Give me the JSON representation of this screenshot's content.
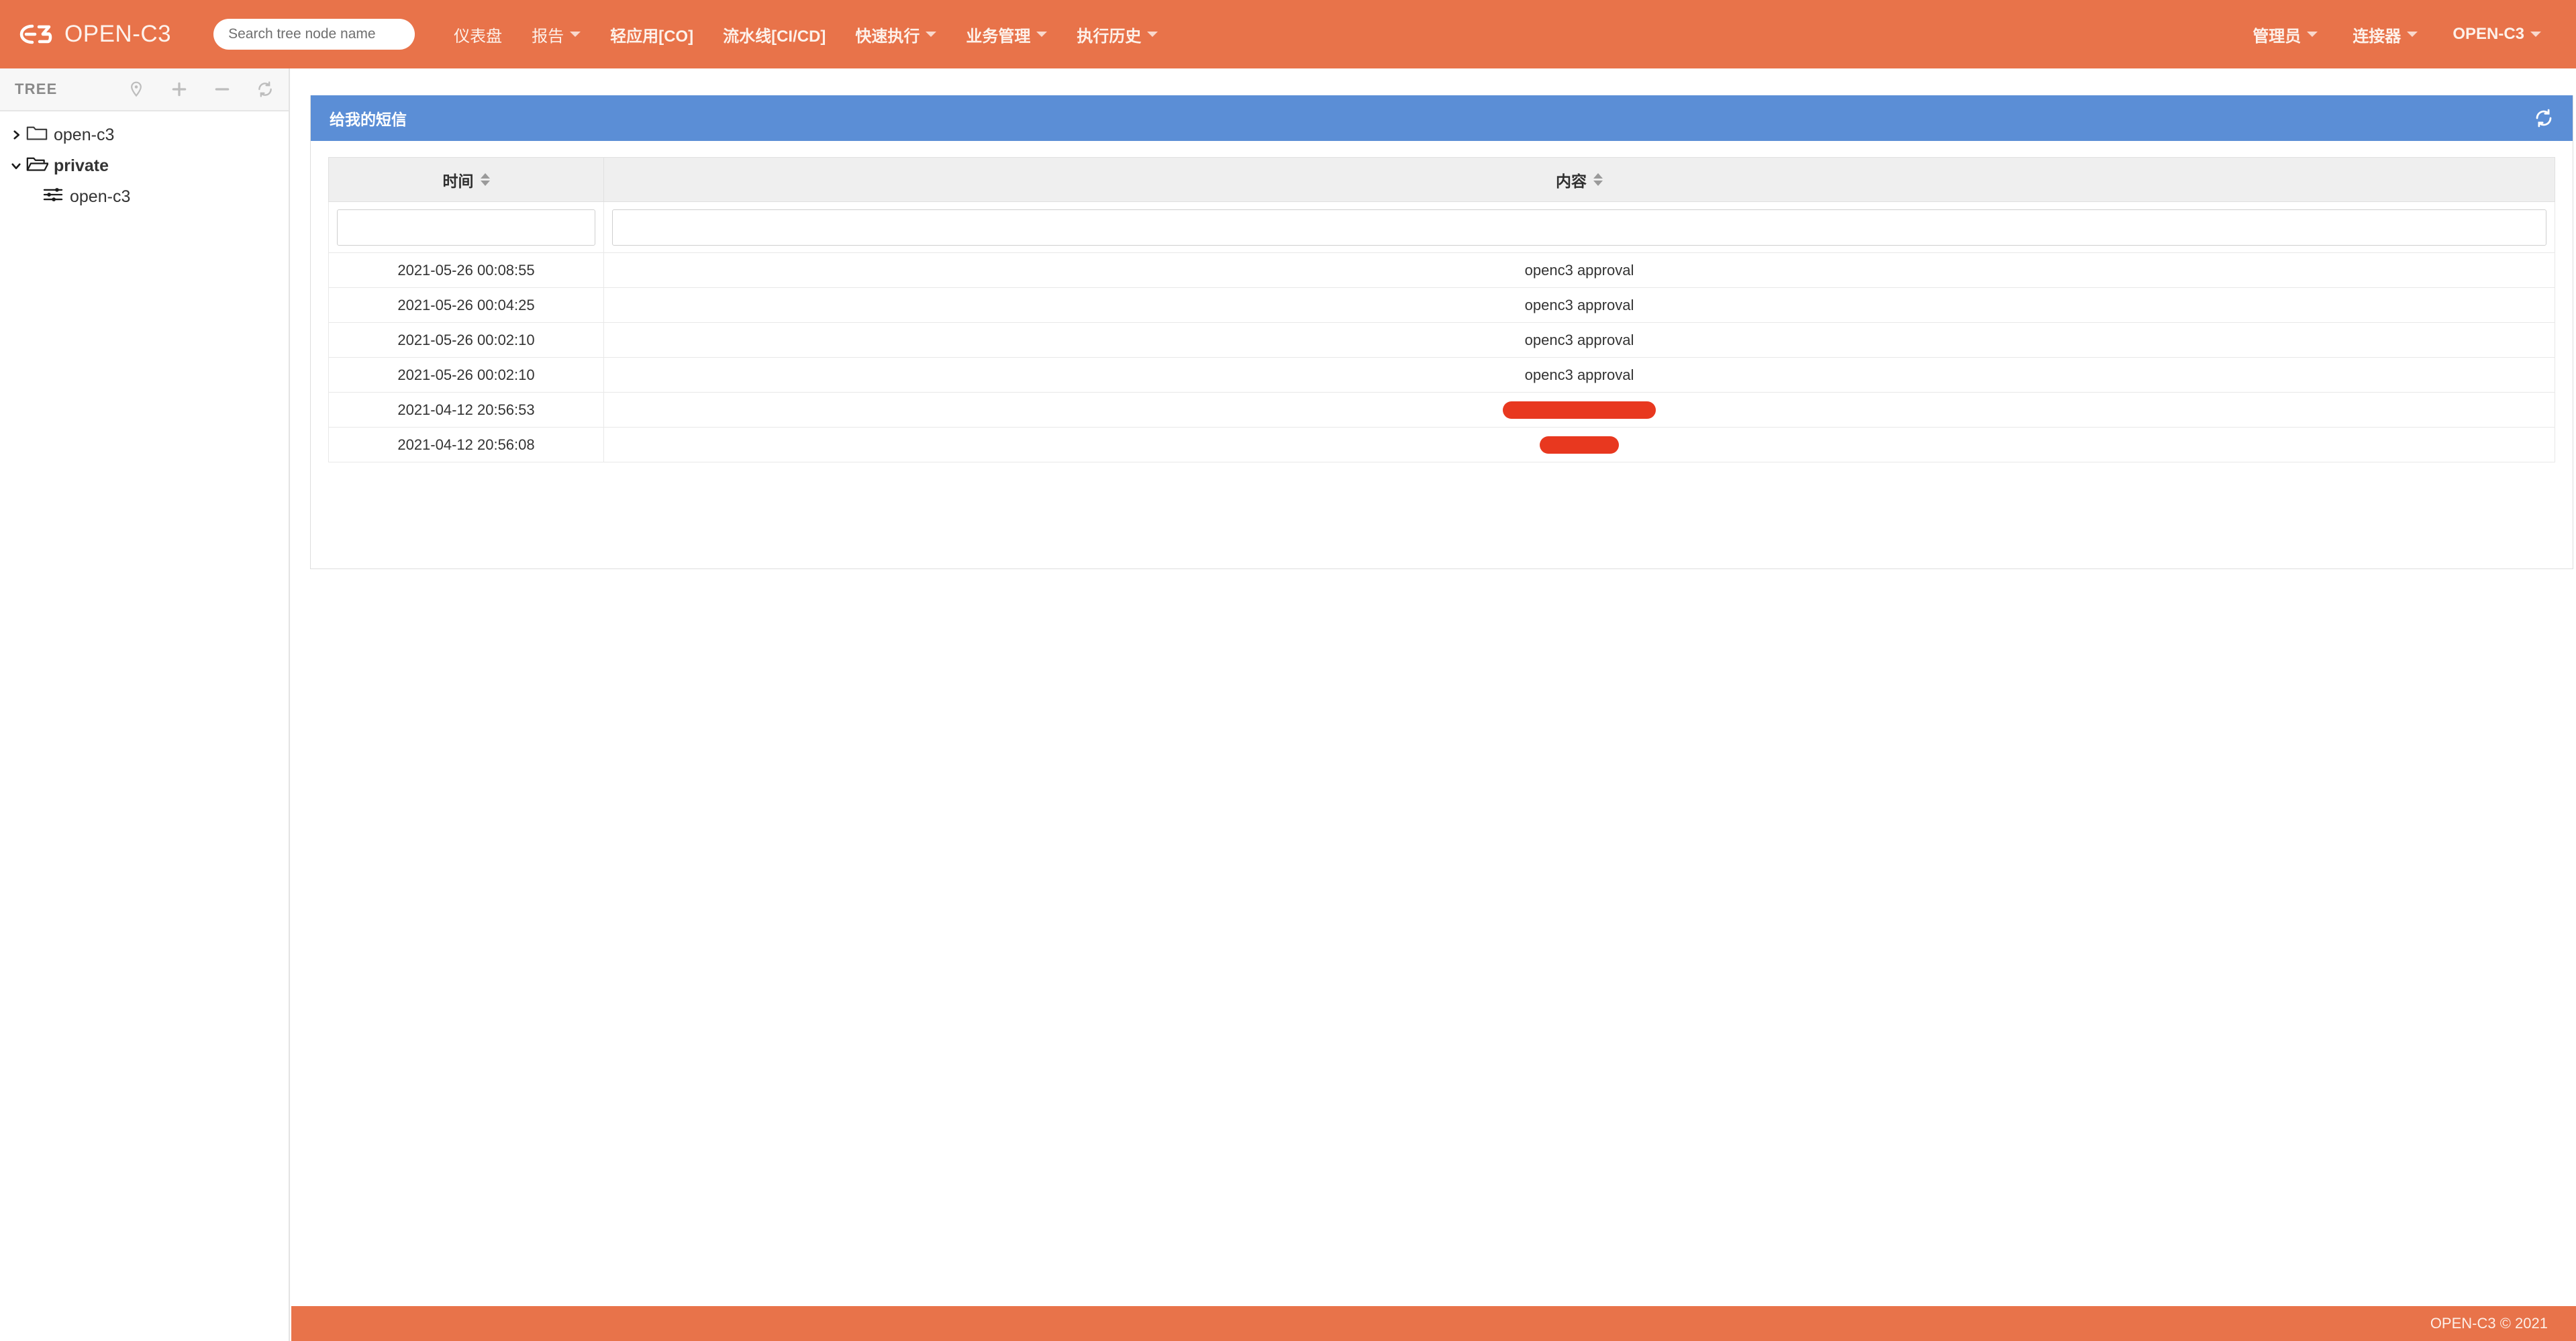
{
  "header": {
    "brand": "OPEN-C3",
    "brand_icon": "c3-logo-icon",
    "search_placeholder": "Search tree node name",
    "search_value": "",
    "nav_items": [
      {
        "label": "仪表盘",
        "has_caret": false
      },
      {
        "label": "报告",
        "has_caret": true
      },
      {
        "label": "轻应用[CO]",
        "has_caret": false
      },
      {
        "label": "流水线[CI/CD]",
        "has_caret": false
      },
      {
        "label": "快速执行",
        "has_caret": true
      },
      {
        "label": "业务管理",
        "has_caret": true
      },
      {
        "label": "执行历史",
        "has_caret": true
      }
    ],
    "right_items": [
      {
        "label": "管理员",
        "has_caret": true
      },
      {
        "label": "连接器",
        "has_caret": true
      },
      {
        "label": "OPEN-C3",
        "has_caret": true
      }
    ]
  },
  "sidebar": {
    "title": "TREE",
    "tools": [
      {
        "name": "locate-icon"
      },
      {
        "name": "add-icon"
      },
      {
        "name": "remove-icon"
      },
      {
        "name": "refresh-icon"
      }
    ],
    "tree": [
      {
        "label": "open-c3",
        "expanded": false,
        "bold": false,
        "level": 0,
        "icon": "folder-closed-icon",
        "arrow": "chevron-right-icon"
      },
      {
        "label": "private",
        "expanded": true,
        "bold": true,
        "level": 0,
        "icon": "folder-open-icon",
        "arrow": "chevron-down-icon"
      },
      {
        "label": "open-c3",
        "expanded": false,
        "bold": false,
        "level": 1,
        "icon": "sliders-icon",
        "arrow": ""
      }
    ]
  },
  "panel": {
    "title": "给我的短信",
    "refresh_icon": "refresh-icon",
    "table": {
      "columns": [
        {
          "label": "时间",
          "sortable": true
        },
        {
          "label": "内容",
          "sortable": true
        }
      ],
      "filters": [
        {
          "value": "",
          "placeholder": ""
        },
        {
          "value": "",
          "placeholder": ""
        }
      ],
      "rows": [
        {
          "time": "2021-05-26 00:08:55",
          "content": "openc3 approval",
          "redacted": false,
          "redact_width": 0
        },
        {
          "time": "2021-05-26 00:04:25",
          "content": "openc3 approval",
          "redacted": false,
          "redact_width": 0
        },
        {
          "time": "2021-05-26 00:02:10",
          "content": "openc3 approval",
          "redacted": false,
          "redact_width": 0
        },
        {
          "time": "2021-05-26 00:02:10",
          "content": "openc3 approval",
          "redacted": false,
          "redact_width": 0
        },
        {
          "time": "2021-04-12 20:56:53",
          "content": "",
          "redacted": true,
          "redact_width": 228
        },
        {
          "time": "2021-04-12 20:56:08",
          "content": "",
          "redacted": true,
          "redact_width": 118
        }
      ]
    }
  },
  "footer": {
    "copyright": "OPEN-C3 © 2021"
  },
  "colors": {
    "brand_orange": "#E8734A",
    "panel_blue": "#5B8ED6",
    "redact_red": "#E8381F"
  }
}
